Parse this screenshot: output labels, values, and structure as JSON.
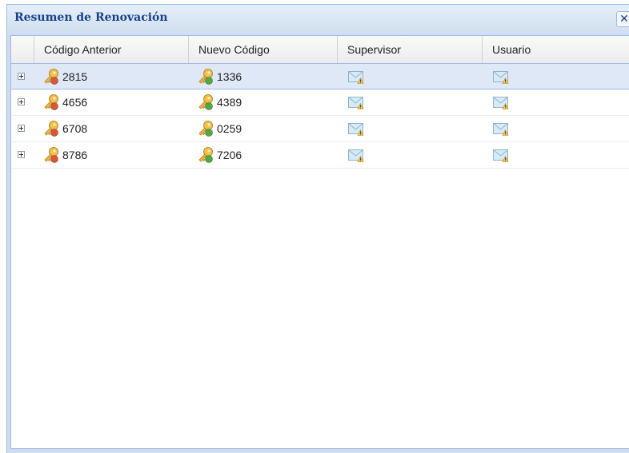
{
  "window": {
    "title": "Resumen de Renovación",
    "close_glyph": "✕"
  },
  "grid": {
    "columns": [
      "Código Anterior",
      "Nuevo Código",
      "Supervisor",
      "Usuario"
    ],
    "rows": [
      {
        "old_code": "2815",
        "new_code": "1336",
        "selected": true
      },
      {
        "old_code": "4656",
        "new_code": "4389",
        "selected": false
      },
      {
        "old_code": "6708",
        "new_code": "0259",
        "selected": false
      },
      {
        "old_code": "8786",
        "new_code": "7206",
        "selected": false
      }
    ]
  },
  "icons": {
    "expander": "plus-expander-icon",
    "old_code": "key-remove-icon",
    "new_code": "key-add-icon",
    "supervisor": "mail-warning-icon",
    "usuario": "mail-warning-icon"
  },
  "colors": {
    "title_text": "#15428b",
    "window_border": "#99bbe8",
    "selected_row": "#dfe8f6"
  }
}
